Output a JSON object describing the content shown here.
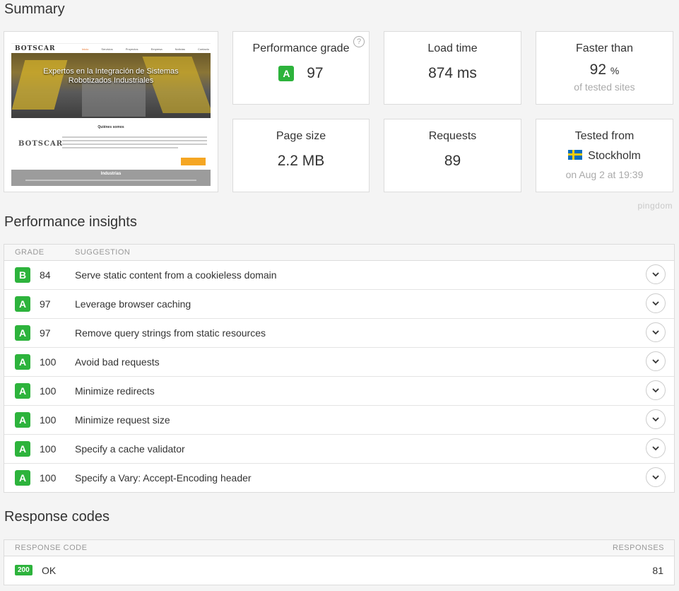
{
  "summary": {
    "title": "Summary",
    "performance_grade": {
      "label": "Performance grade",
      "grade": "A",
      "score": "97"
    },
    "load_time": {
      "label": "Load time",
      "value": "874 ms"
    },
    "faster_than": {
      "label": "Faster than",
      "value": "92",
      "unit": "%",
      "sub": "of tested sites"
    },
    "page_size": {
      "label": "Page size",
      "value": "2.2 MB"
    },
    "requests": {
      "label": "Requests",
      "value": "89"
    },
    "tested_from": {
      "label": "Tested from",
      "location": "Stockholm",
      "sub": "on Aug 2 at 19:39",
      "flag_icon": "sweden-flag-icon"
    },
    "brand": "pingdom",
    "screenshot": {
      "logo": "BOTSCAR",
      "hero_text_line1": "Expertos en la Integración de Sistemas",
      "hero_text_line2": "Robotizados Industriales",
      "section_title": "Quiénes somos",
      "footer_title": "Industrias",
      "nav": [
        "Inicio",
        "Servicios",
        "Proyectos",
        "Empresa",
        "Noticias",
        "Contacto"
      ]
    }
  },
  "insights": {
    "title": "Performance insights",
    "col_grade": "GRADE",
    "col_suggestion": "SUGGESTION",
    "rows": [
      {
        "grade": "B",
        "score": "84",
        "suggestion": "Serve static content from a cookieless domain"
      },
      {
        "grade": "A",
        "score": "97",
        "suggestion": "Leverage browser caching"
      },
      {
        "grade": "A",
        "score": "97",
        "suggestion": "Remove query strings from static resources"
      },
      {
        "grade": "A",
        "score": "100",
        "suggestion": "Avoid bad requests"
      },
      {
        "grade": "A",
        "score": "100",
        "suggestion": "Minimize redirects"
      },
      {
        "grade": "A",
        "score": "100",
        "suggestion": "Minimize request size"
      },
      {
        "grade": "A",
        "score": "100",
        "suggestion": "Specify a cache validator"
      },
      {
        "grade": "A",
        "score": "100",
        "suggestion": "Specify a Vary: Accept-Encoding header"
      }
    ]
  },
  "response_codes": {
    "title": "Response codes",
    "col_code": "RESPONSE CODE",
    "col_responses": "RESPONSES",
    "rows": [
      {
        "code": "200",
        "status": "OK",
        "responses": "81"
      }
    ]
  },
  "colors": {
    "grade_green": "#2db33c",
    "background": "#f4f4f4"
  }
}
